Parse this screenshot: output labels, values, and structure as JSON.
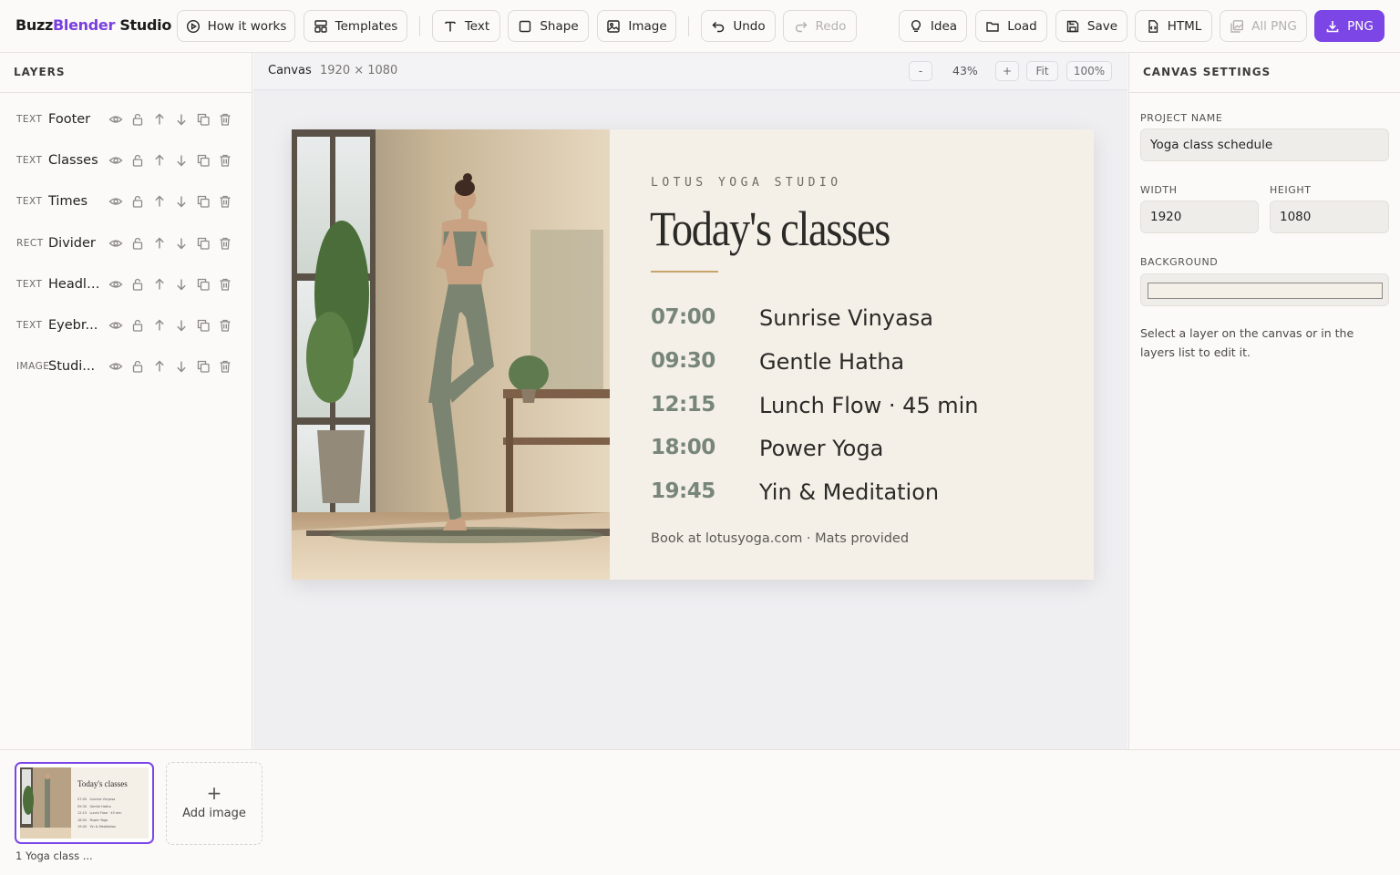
{
  "brand": {
    "part1": "Buzz",
    "part2": "Blender",
    "part3": " Studio",
    "accent": "#7a3fe0"
  },
  "toolbar": {
    "how_it_works": "How it works",
    "templates": "Templates",
    "text": "Text",
    "shape": "Shape",
    "image": "Image",
    "undo": "Undo",
    "redo": "Redo",
    "idea": "Idea",
    "load": "Load",
    "save": "Save",
    "html": "HTML",
    "all_png": "All PNG",
    "png": "PNG"
  },
  "layers": {
    "title": "LAYERS",
    "items": [
      {
        "type": "TEXT",
        "name": "Footer"
      },
      {
        "type": "TEXT",
        "name": "Classes"
      },
      {
        "type": "TEXT",
        "name": "Times"
      },
      {
        "type": "RECT",
        "name": "Divider"
      },
      {
        "type": "TEXT",
        "name": "Headli..."
      },
      {
        "type": "TEXT",
        "name": "Eyebr..."
      },
      {
        "type": "IMAGE",
        "name": "Studi..."
      }
    ]
  },
  "canvas": {
    "title": "Canvas",
    "size": "1920 × 1080",
    "zoom_out": "-",
    "zoom": "43%",
    "zoom_in": "+",
    "fit": "Fit",
    "actual": "100%"
  },
  "poster": {
    "eyebrow": "LOTUS YOGA STUDIO",
    "headline": "Today's classes",
    "classes": [
      {
        "time": "07:00",
        "name": "Sunrise Vinyasa"
      },
      {
        "time": "09:30",
        "name": "Gentle Hatha"
      },
      {
        "time": "12:15",
        "name": "Lunch Flow · 45 min"
      },
      {
        "time": "18:00",
        "name": "Power Yoga"
      },
      {
        "time": "19:45",
        "name": "Yin & Meditation"
      }
    ],
    "footer": "Book at lotusyoga.com · Mats provided",
    "background": "#f4f0e8",
    "accent": "#c9a46a",
    "time_color": "#78867a"
  },
  "settings": {
    "title": "CANVAS SETTINGS",
    "project_name_label": "PROJECT NAME",
    "project_name": "Yoga class schedule",
    "width_label": "WIDTH",
    "width": "1920",
    "height_label": "HEIGHT",
    "height": "1080",
    "background_label": "BACKGROUND",
    "hint": "Select a layer on the canvas or in the layers list to edit it."
  },
  "filmstrip": {
    "thumb_label": "1 Yoga class ...",
    "add_image": "Add image",
    "add_plus": "+"
  }
}
